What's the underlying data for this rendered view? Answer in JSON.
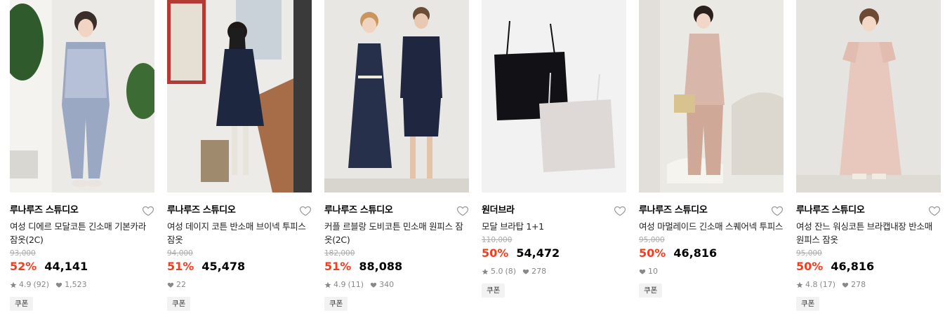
{
  "icons": {
    "wish": "heart-outline-icon",
    "rating": "star-icon",
    "likes": "heart-filled-icon"
  },
  "colors": {
    "discount": "#f33d1e",
    "text": "#000000",
    "muted": "#888888",
    "strike": "#aaaaaa"
  },
  "products": [
    {
      "brand": "루나루즈 스튜디오",
      "title": "여성 디에르 모달코튼 긴소매 기본카라 잠옷(2C)",
      "original_price": "93,000",
      "discount": "52%",
      "price": "44,141",
      "rating": "4.9",
      "reviews": "(92)",
      "likes": "1,523",
      "coupon": "쿠폰"
    },
    {
      "brand": "루나루즈 스튜디오",
      "title": "여성 데이지 코튼 반소매 브이넥 투피스 잠옷",
      "original_price": "94,000",
      "discount": "51%",
      "price": "45,478",
      "likes": "22",
      "coupon": "쿠폰"
    },
    {
      "brand": "루나루즈 스튜디오",
      "title": "커플 르블랑 도비코튼 민소매 원피스 잠옷(2C)",
      "original_price": "182,000",
      "discount": "51%",
      "price": "88,088",
      "rating": "4.9",
      "reviews": "(11)",
      "likes": "340",
      "coupon": "쿠폰"
    },
    {
      "brand": "원더브라",
      "title": "모달 브라탑 1+1",
      "original_price": "110,000",
      "discount": "50%",
      "price": "54,472",
      "rating": "5.0",
      "reviews": "(8)",
      "likes": "278",
      "coupon": "쿠폰"
    },
    {
      "brand": "루나루즈 스튜디오",
      "title": "여성 마멀레이드 긴소매 스퀘어넥 투피스",
      "original_price": "95,000",
      "discount": "50%",
      "price": "46,816",
      "likes": "10",
      "coupon": "쿠폰"
    },
    {
      "brand": "루나루즈 스튜디오",
      "title": "여성 잔느 워싱코튼 브라캡내장 반소매 원피스 잠옷",
      "original_price": "95,000",
      "discount": "50%",
      "price": "46,816",
      "rating": "4.8",
      "reviews": "(17)",
      "likes": "278",
      "coupon": "쿠폰"
    }
  ]
}
